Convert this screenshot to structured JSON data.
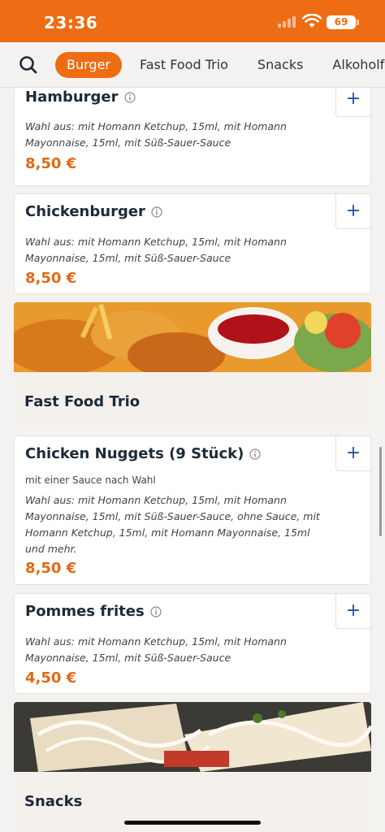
{
  "status_bar": {
    "time": "23:36",
    "battery": "69"
  },
  "nav": {
    "tabs": [
      {
        "label": "Burger",
        "active": true
      },
      {
        "label": "Fast Food Trio",
        "active": false
      },
      {
        "label": "Snacks",
        "active": false
      },
      {
        "label": "Alkoholfrei",
        "active": false
      }
    ]
  },
  "items": [
    {
      "name": "Hamburger",
      "desc": "Wahl aus: mit Homann Ketchup, 15ml, mit Homann Mayonnaise, 15ml, mit Süß-Sauer-Sauce",
      "price": "8,50 €"
    },
    {
      "name": "Chickenburger",
      "desc": "Wahl aus: mit Homann Ketchup, 15ml, mit Homann Mayonnaise, 15ml, mit Süß-Sauer-Sauce",
      "price": "8,50 €"
    },
    {
      "name": "Chicken Nuggets (9 Stück)",
      "short_desc": "mit einer Sauce nach Wahl",
      "desc": "Wahl aus: mit Homann Ketchup, 15ml, mit Homann Mayonnaise, 15ml, mit Süß-Sauer-Sauce, ohne Sauce, mit Homann Ketchup, 15ml, mit Homann Mayonnaise, 15ml und mehr.",
      "price": "8,50 €"
    },
    {
      "name": "Pommes frites",
      "desc": "Wahl aus: mit Homann Ketchup, 15ml, mit Homann Mayonnaise, 15ml, mit Süß-Sauer-Sauce",
      "price": "4,50 €"
    }
  ],
  "categories": [
    {
      "title": "Fast Food Trio"
    },
    {
      "title": "Snacks"
    }
  ],
  "add_label": "+",
  "colors": {
    "brand": "#ee6c14",
    "price": "#e06a14",
    "add": "#1d57a8"
  },
  "icons": [
    "search-icon",
    "info-icon",
    "plus-icon",
    "wifi-icon",
    "signal-icon",
    "battery-icon"
  ]
}
